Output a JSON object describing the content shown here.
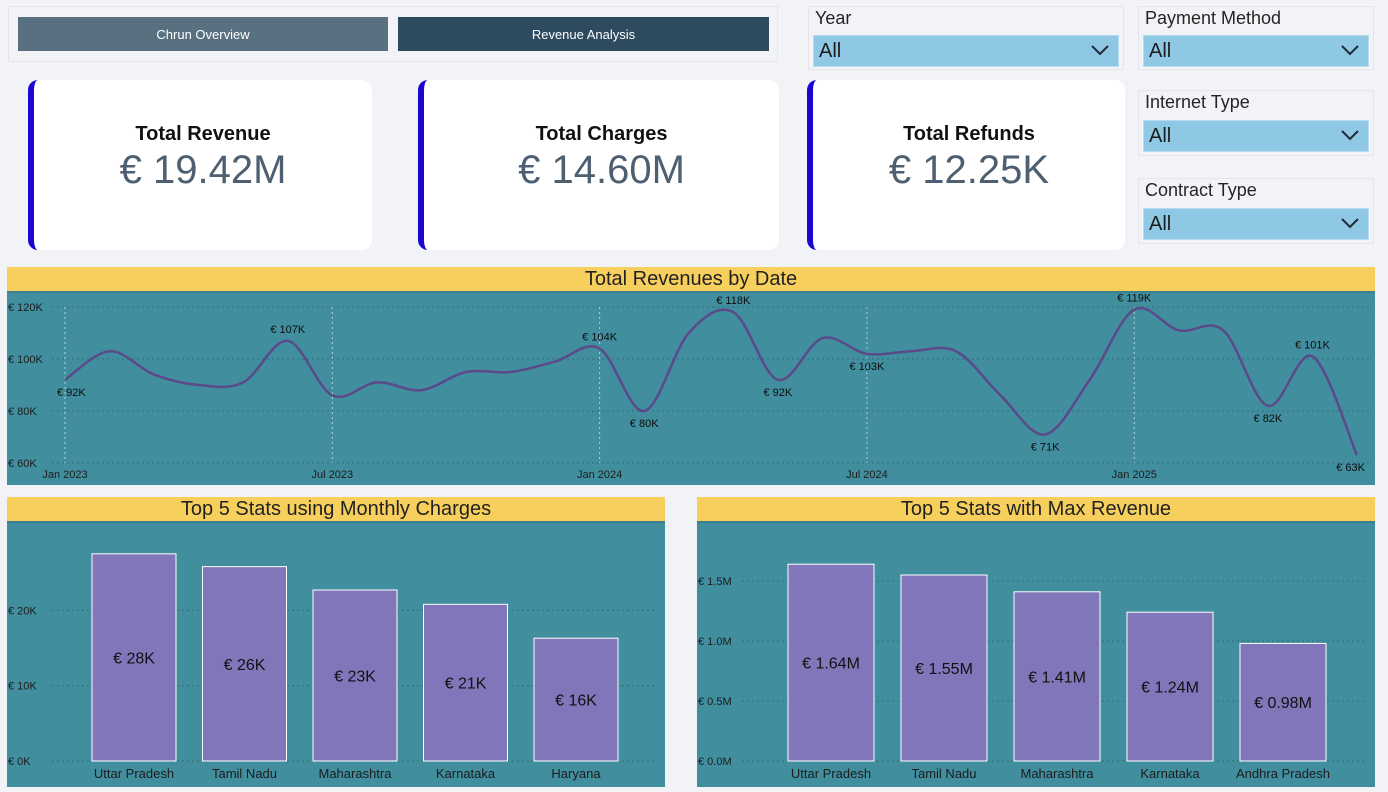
{
  "nav": {
    "overview_label": "Chrun Overview",
    "revenue_label": "Revenue Analysis"
  },
  "kpis": [
    {
      "title": "Total Revenue",
      "value": "€ 19.42M"
    },
    {
      "title": "Total Charges",
      "value": "€ 14.60M"
    },
    {
      "title": "Total Refunds",
      "value": "€ 12.25K"
    }
  ],
  "slicers": {
    "year": {
      "label": "Year",
      "value": "All"
    },
    "payment_method": {
      "label": "Payment Method",
      "value": "All"
    },
    "internet_type": {
      "label": "Internet Type",
      "value": "All"
    },
    "contract_type": {
      "label": "Contract Type",
      "value": "All"
    }
  },
  "colors": {
    "accent_bar": "#1a06d0",
    "chart_bg": "#418e9f",
    "title_bar": "#f7cf5d",
    "line": "#5a4a8a",
    "bar_fill": "#8176ba",
    "slicer_fill": "#8fc8e4"
  },
  "icons": {
    "dropdown": "chevron-down-icon"
  },
  "chart_data": [
    {
      "type": "line",
      "title": "Total Revenues by Date",
      "x_ticks": [
        "Jan 2023",
        "Jul 2023",
        "Jan 2024",
        "Jul 2024",
        "Jan 2025"
      ],
      "y_ticks": [
        "€ 60K",
        "€ 80K",
        "€ 100K",
        "€ 120K"
      ],
      "ylim": [
        60,
        120
      ],
      "x": [
        "2023-01",
        "2023-02",
        "2023-03",
        "2023-04",
        "2023-05",
        "2023-06",
        "2023-07",
        "2023-08",
        "2023-09",
        "2023-10",
        "2023-11",
        "2023-12",
        "2024-01",
        "2024-02",
        "2024-03",
        "2024-04",
        "2024-05",
        "2024-06",
        "2024-07",
        "2024-08",
        "2024-09",
        "2024-10",
        "2024-11",
        "2024-12",
        "2025-01",
        "2025-02",
        "2025-03",
        "2025-04",
        "2025-05",
        "2025-06"
      ],
      "values": [
        92,
        103,
        94,
        90,
        91,
        107,
        86,
        91,
        88,
        95,
        95,
        99,
        104,
        80,
        110,
        118,
        92,
        108,
        102,
        103,
        103,
        86,
        71,
        92,
        119,
        111,
        111,
        82,
        101,
        63
      ],
      "data_labels": [
        {
          "i": 0,
          "text": "€ 92K"
        },
        {
          "i": 5,
          "text": "€ 107K"
        },
        {
          "i": 12,
          "text": "€ 104K"
        },
        {
          "i": 13,
          "text": "€ 80K"
        },
        {
          "i": 15,
          "text": "€ 118K"
        },
        {
          "i": 16,
          "text": "€ 92K"
        },
        {
          "i": 18,
          "text": "€ 103K"
        },
        {
          "i": 22,
          "text": "€ 71K"
        },
        {
          "i": 24,
          "text": "€ 119K"
        },
        {
          "i": 27,
          "text": "€ 82K"
        },
        {
          "i": 28,
          "text": "€ 101K"
        },
        {
          "i": 29,
          "text": "€ 63K"
        }
      ],
      "grid": true
    },
    {
      "type": "bar",
      "title": "Top 5 Stats using Monthly Charges",
      "categories": [
        "Uttar Pradesh",
        "Tamil Nadu",
        "Maharashtra",
        "Karnataka",
        "Haryana"
      ],
      "values": [
        27.5,
        25.8,
        22.7,
        20.8,
        16.3
      ],
      "labels": [
        "€ 28K",
        "€ 26K",
        "€ 23K",
        "€ 21K",
        "€ 16K"
      ],
      "y_ticks": [
        "€ 0K",
        "€ 10K",
        "€ 20K"
      ],
      "ylim": [
        0,
        30
      ]
    },
    {
      "type": "bar",
      "title": "Top 5 Stats with Max Revenue",
      "categories": [
        "Uttar Pradesh",
        "Tamil Nadu",
        "Maharashtra",
        "Karnataka",
        "Andhra Pradesh"
      ],
      "values": [
        1.64,
        1.55,
        1.41,
        1.24,
        0.98
      ],
      "labels": [
        "€ 1.64M",
        "€ 1.55M",
        "€ 1.41M",
        "€ 1.24M",
        "€ 0.98M"
      ],
      "y_ticks": [
        "€ 0.0M",
        "€ 0.5M",
        "€ 1.0M",
        "€ 1.5M"
      ],
      "ylim": [
        0,
        1.65
      ]
    }
  ]
}
